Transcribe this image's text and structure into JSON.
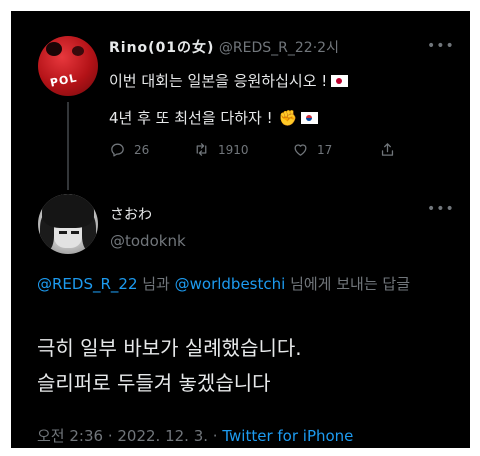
{
  "parent_tweet": {
    "display_name": "Rino(01の女)",
    "handle": "@REDS_R_22",
    "time_ago": "2시",
    "line1": "이번 대회는 일본을 응원하십시오 !",
    "line2": "4년 후 또 최선을 다하자 !",
    "more_icon": "•••",
    "avatar_text": "POL",
    "emoji": {
      "flag_japan": "flag-japan",
      "fist": "oncoming-fist",
      "flag_korea": "flag-korea"
    },
    "actions": {
      "reply_count": "26",
      "retweet_count": "1910",
      "like_count": "17"
    }
  },
  "reply_tweet": {
    "display_name": "さおわ",
    "handle": "@todoknk",
    "more_icon": "•••",
    "replying_mention_1": "@REDS_R_22",
    "replying_conj": " 님과 ",
    "replying_mention_2": "@worldbestchi",
    "replying_suffix": " 님에게 보내는 답글",
    "body_line1": "극히 일부 바보가 실례했습니다.",
    "body_line2": "슬리퍼로 두들겨 놓겠습니다",
    "time": "오전 2:36",
    "date": "2022. 12. 3.",
    "separator": " · ",
    "source": "Twitter for iPhone"
  },
  "colors": {
    "background": "#000000",
    "text_primary": "#e7e9ea",
    "text_secondary": "#71767b",
    "link": "#1d9bf0"
  }
}
